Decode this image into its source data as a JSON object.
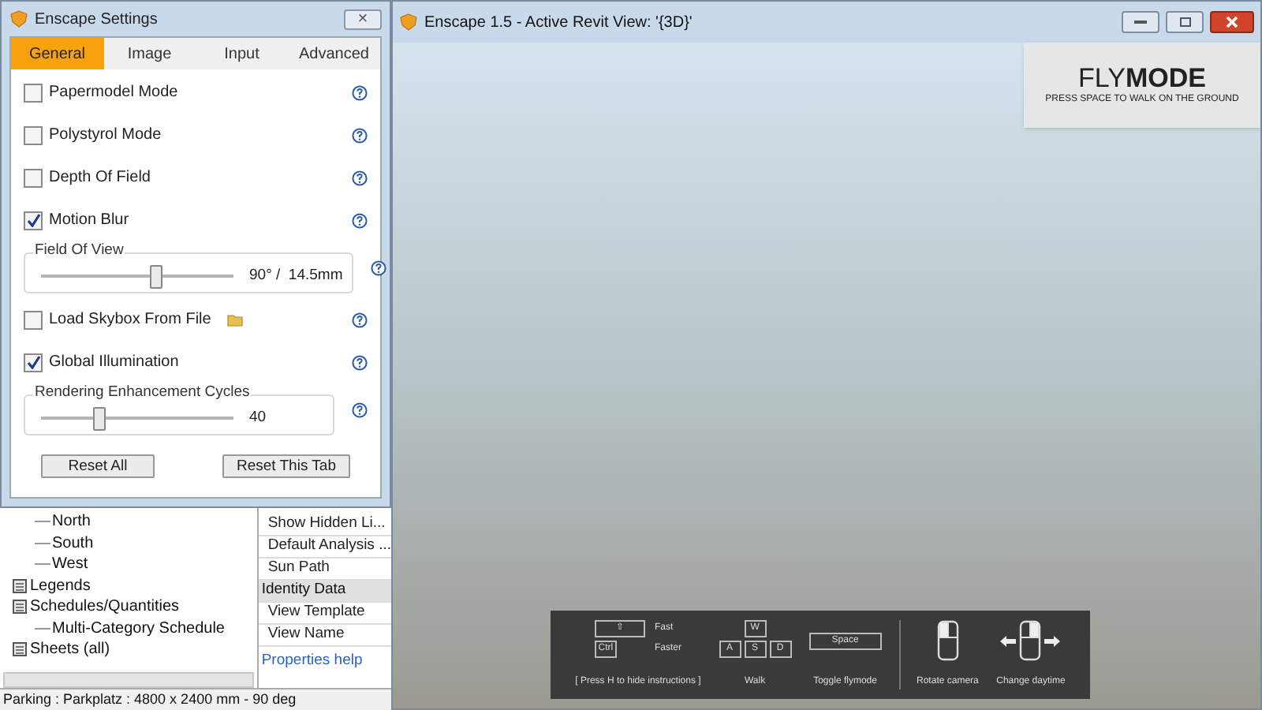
{
  "settings_dialog": {
    "title": "Enscape Settings",
    "close": "×",
    "tabs": [
      {
        "label": "General",
        "selected": true
      },
      {
        "label": "Image",
        "selected": false
      },
      {
        "label": "Input",
        "selected": false
      },
      {
        "label": "Advanced",
        "selected": false
      }
    ],
    "options": [
      {
        "kind": "checkbox",
        "label": "Papermodel Mode",
        "checked": false
      },
      {
        "kind": "checkbox",
        "label": "Polystyrol Mode",
        "checked": false
      },
      {
        "kind": "checkbox",
        "label": "Depth Of Field",
        "checked": false
      },
      {
        "kind": "checkbox",
        "label": "Motion Blur",
        "checked": true
      },
      {
        "kind": "slider",
        "label": "Field Of View",
        "level": 0.6,
        "reading": "90° /  14.5mm"
      },
      {
        "kind": "checkbox",
        "label": "Load Skybox From File",
        "checked": false,
        "folder_button": true
      },
      {
        "kind": "checkbox",
        "label": "Global Illumination",
        "checked": true
      },
      {
        "kind": "slider",
        "label": "Rendering Enhancement Cycles",
        "level": 0.3,
        "reading": "40"
      }
    ],
    "buttons": [
      "Reset All",
      "Reset This Tab"
    ]
  },
  "project_browser": {
    "items": [
      {
        "kind": "view",
        "label": "North"
      },
      {
        "kind": "view",
        "label": "South"
      },
      {
        "kind": "view",
        "label": "West"
      },
      {
        "kind": "legend",
        "label": "Legends"
      },
      {
        "kind": "schedule",
        "label": "Schedules/Quantities",
        "children": [
          {
            "kind": "view",
            "label": "Multi-Category Schedule"
          }
        ]
      },
      {
        "kind": "sheet",
        "label": "Sheets (all)"
      }
    ]
  },
  "properties": {
    "rows": [
      {
        "kind": "field",
        "label": "Show Hidden Li..."
      },
      {
        "kind": "field",
        "label": "Default Analysis ..."
      },
      {
        "kind": "field",
        "label": "Sun Path"
      },
      {
        "kind": "group",
        "label": "Identity Data"
      },
      {
        "kind": "field",
        "label": "View Template"
      },
      {
        "kind": "field",
        "label": "View Name"
      }
    ],
    "help_link": "Properties help"
  },
  "status_bar": "Parking : Parkplatz : 4800 x 2400 mm - 90 deg",
  "viewer": {
    "title": "Enscape 1.5 - Active Revit View: '{3D}'",
    "mode_banner": {
      "light": "FLY",
      "bold": "MODE",
      "hint": "PRESS SPACE TO WALK ON THE GROUND"
    },
    "instructions": [
      {
        "kind": "speed",
        "keys": [
          "⇧",
          "Ctrl"
        ],
        "labels": [
          "Fast",
          "Faster"
        ],
        "caption": "[ Press H to hide instructions ]"
      },
      {
        "kind": "walk",
        "keys": [
          "W",
          "A",
          "S",
          "D"
        ],
        "caption": "Walk"
      },
      {
        "kind": "toggle",
        "keys": [
          "Space"
        ],
        "caption": "Toggle flymode"
      },
      {
        "kind": "rotate",
        "caption": "Rotate camera"
      },
      {
        "kind": "daytime",
        "caption": "Change daytime"
      }
    ]
  }
}
